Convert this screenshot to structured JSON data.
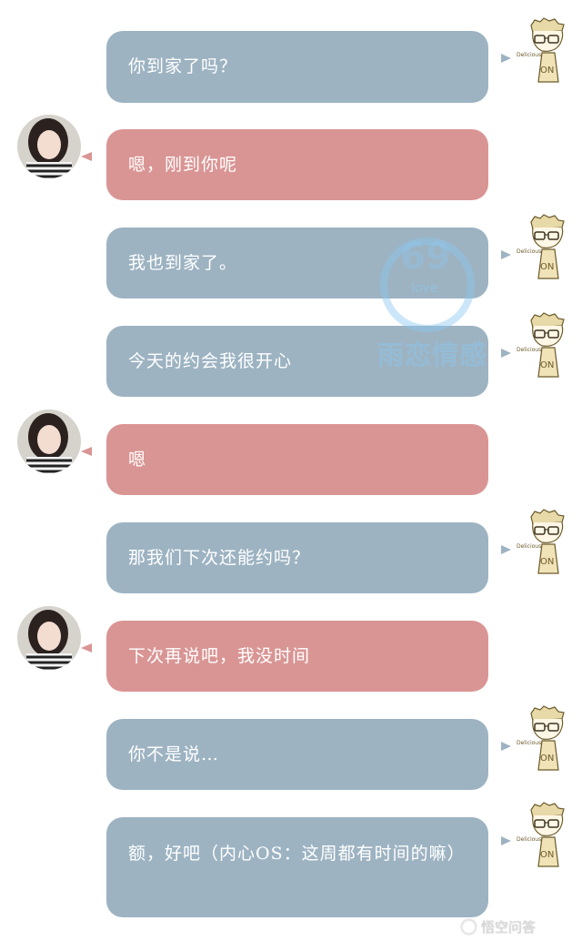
{
  "messages": [
    {
      "side": "right",
      "text": "你到家了吗？"
    },
    {
      "side": "left",
      "text": "嗯，刚到你呢"
    },
    {
      "side": "right",
      "text": "我也到家了。"
    },
    {
      "side": "right",
      "text": "今天的约会我很开心"
    },
    {
      "side": "left",
      "text": "嗯"
    },
    {
      "side": "right",
      "text": "那我们下次还能约吗？"
    },
    {
      "side": "left",
      "text": "下次再说吧，我没时间"
    },
    {
      "side": "right",
      "text": "你不是说…"
    },
    {
      "side": "right",
      "text": "额，好吧（内心OS：这周都有时间的嘛）"
    }
  ],
  "watermark": {
    "brand": "雨恋情感",
    "love": "love",
    "number": "69"
  },
  "footer_logo": "悟空问答",
  "colors": {
    "blue_bubble": "#9db3c2",
    "pink_bubble": "#d99594"
  },
  "icons": {
    "boy_avatar": "sketch-boy-icon",
    "girl_avatar": "girl-photo-avatar"
  }
}
